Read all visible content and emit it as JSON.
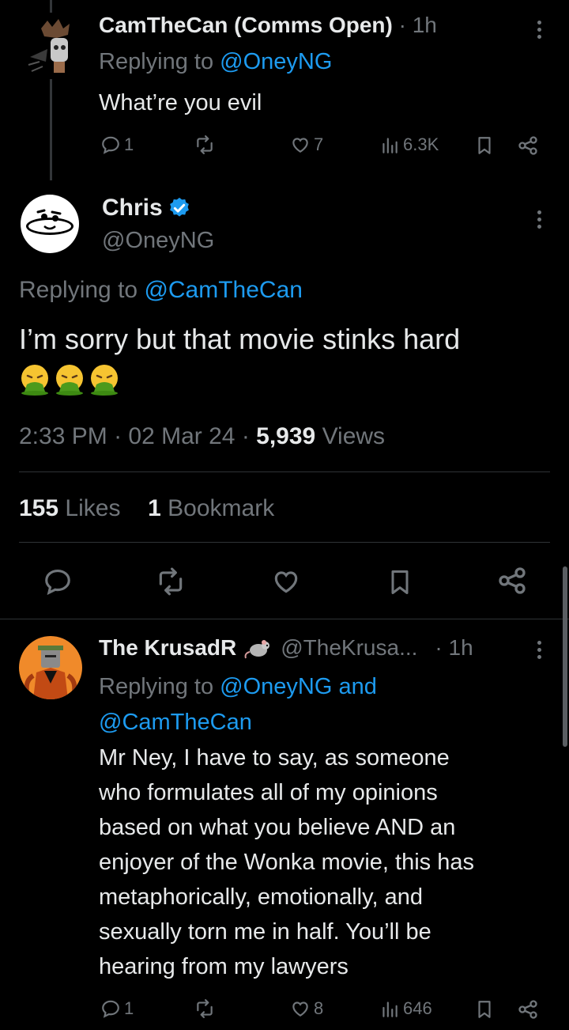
{
  "reply1": {
    "name": "CamTheCan (Comms Open)",
    "time": "· 1h",
    "replying_prefix": "Replying to ",
    "replying_handle": "@OneyNG",
    "text": "What’re you evil",
    "stats": {
      "replies": "1",
      "reposts": "",
      "likes": "7",
      "views": "6.3K"
    }
  },
  "main_tweet": {
    "name": "Chris",
    "handle": "@OneyNG",
    "replying_prefix": "Replying to ",
    "replying_handle": "@CamTheCan",
    "text": "I’m sorry but that movie stinks hard",
    "emojis": [
      "nauseated-face",
      "nauseated-face",
      "nauseated-face"
    ],
    "time": "2:33 PM",
    "date": "02 Mar 24",
    "views_count": "5,939",
    "views_label": "Views",
    "likes_count": "155",
    "likes_label": "Likes",
    "bookmarks_count": "1",
    "bookmarks_label": "Bookmark"
  },
  "reply2": {
    "name": "The KrusadR",
    "handle": "@TheKrusa...",
    "time": "· 1h",
    "replying_prefix": "Replying to ",
    "replying_line1": "@OneyNG and",
    "replying_line2": "@CamTheCan",
    "text_lines": [
      "Mr Ney, I have to say, as someone",
      "who formulates all of my opinions",
      "based on what you believe AND an",
      "enjoyer of the Wonka movie, this has",
      "metaphorically, emotionally, and",
      "sexually torn me in half. You’ll be",
      "hearing from my lawyers"
    ],
    "stats": {
      "replies": "1",
      "reposts": "",
      "likes": "8",
      "views": "646"
    }
  },
  "colors": {
    "background": "#000000",
    "text": "#e7e9ea",
    "muted": "#71767b",
    "link": "#1d9bf0",
    "verified": "#1d9bf0"
  }
}
